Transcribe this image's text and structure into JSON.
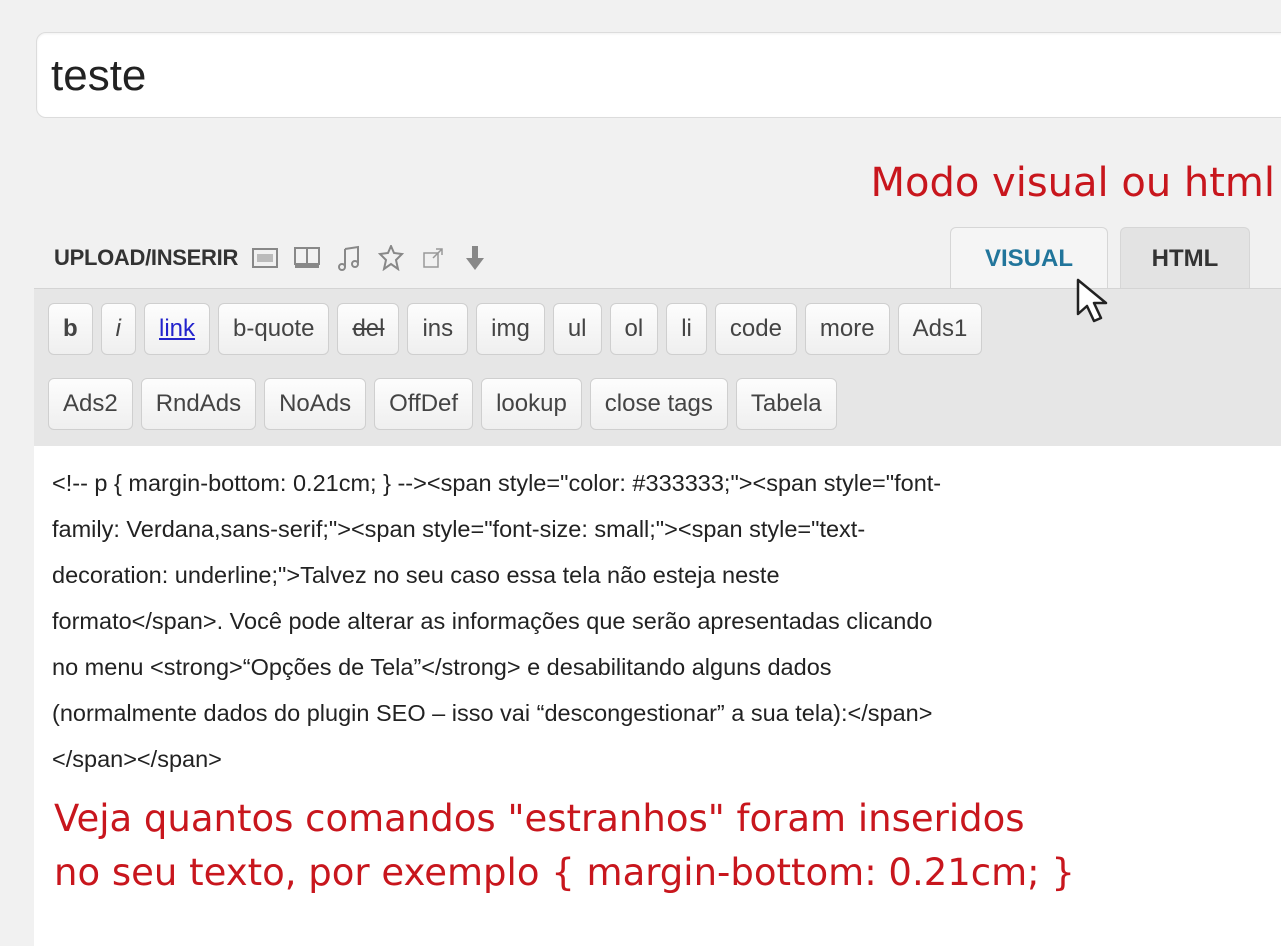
{
  "post_title": "teste",
  "annotations": {
    "top": "Modo visual ou html",
    "bottom_line1": "Veja quantos comandos \"estranhos\" foram inseridos",
    "bottom_line2": "no seu texto, por exemplo { margin-bottom: 0.21cm; }"
  },
  "media_bar": {
    "label": "UPLOAD/INSERIR",
    "icons": [
      "image-icon",
      "gallery-icon",
      "audio-icon",
      "media-icon",
      "external-link-icon",
      "download-icon"
    ]
  },
  "tabs": {
    "visual": "VISUAL",
    "html": "HTML"
  },
  "quicktags": {
    "row1": [
      "b",
      "i",
      "link",
      "b-quote",
      "del",
      "ins",
      "img",
      "ul",
      "ol",
      "li",
      "code",
      "more",
      "Ads1"
    ],
    "row2": [
      "Ads2",
      "RndAds",
      "NoAds",
      "OffDef",
      "lookup",
      "close tags",
      "Tabela"
    ]
  },
  "editor": {
    "lines": [
      "<!-- p { margin-bottom: 0.21cm; } --><span style=\"color: #333333;\"><span style=\"font-",
      "family: Verdana,sans-serif;\"><span style=\"font-size: small;\"><span style=\"text-",
      "decoration: underline;\">Talvez no seu caso essa tela não esteja neste",
      "formato</span>. Você pode alterar as informações que serão apresentadas clicando",
      "no menu <strong>“Opções de Tela”</strong> e desabilitando alguns dados",
      "(normalmente dados do plugin SEO – isso vai “descongestionar” a sua tela):</span>",
      "</span></span>"
    ]
  },
  "colors": {
    "annotation": "#c8161d",
    "visual_tab_text": "#21759b",
    "link_button": "#2222cc"
  }
}
